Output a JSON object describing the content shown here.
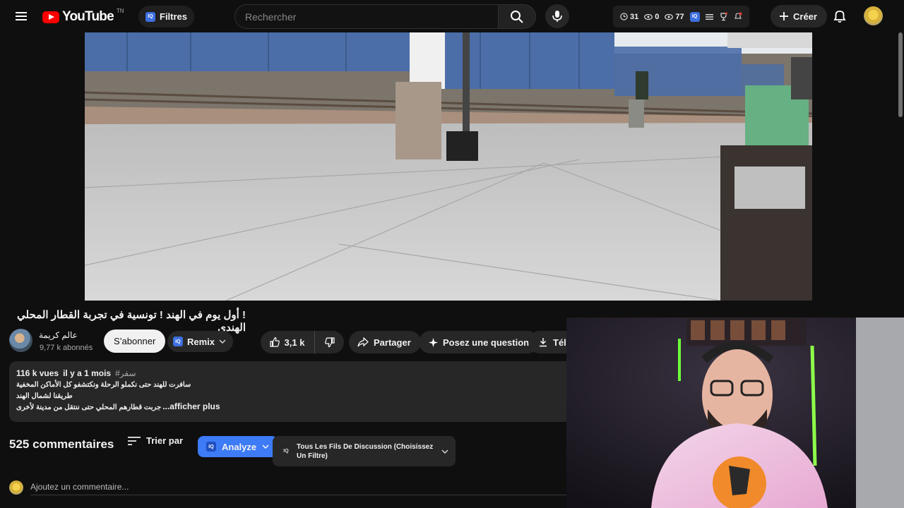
{
  "header": {
    "logo_text": "YouTube",
    "logo_region": "TN",
    "filters_label": "Filtres",
    "search_placeholder": "Rechercher",
    "stats": {
      "timer": "31",
      "eye_a": "0",
      "eye_b": "77"
    },
    "create_label": "Créer",
    "iq_badge": "IQ"
  },
  "video": {
    "title": "! أول يوم في الهند ! تونسية في تجربة القطار المحلي الهندي"
  },
  "channel": {
    "name": "عالم كريمة",
    "subscribers": "9,77 k abonnés",
    "subscribe_label": "S’abonner",
    "remix_label": "Remix"
  },
  "actions": {
    "likes": "3,1 k",
    "share_label": "Partager",
    "ask_label": "Posez une question",
    "download_label": "Télé"
  },
  "description": {
    "views": "116 k vues",
    "date": "il y a 1 mois",
    "hashtag": "#سفر",
    "lines": [
      "سافرت للهند حتى نكملو الرحلة ونكتشفو كل الأماكن المخفية",
      "طريقنا لشمال الهند"
    ],
    "last_line": "جربت قطارهم المحلي حتى ننتقل من مدينة لأخرى",
    "more_label": "...afficher plus"
  },
  "comments": {
    "count_label": "525 commentaires",
    "sort_label": "Trier par",
    "analyze_label": "Analyze",
    "threads_label": "Tous Les Fils De Discussion (Choisissez Un Filtre)",
    "add_placeholder": "Ajoutez un commentaire..."
  },
  "colors": {
    "background": "#0f0f0f",
    "youtube_red": "#ff0000",
    "iq_blue": "#3d6fe0",
    "analyze_blue": "#3d7bf7"
  }
}
